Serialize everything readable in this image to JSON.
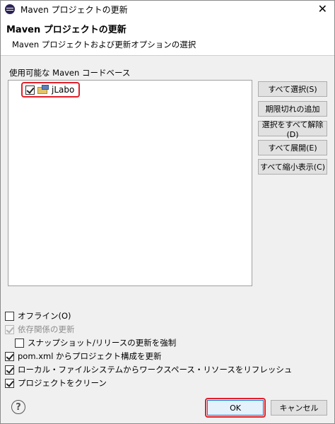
{
  "window": {
    "title": "Maven プロジェクトの更新",
    "close_glyph": "✕"
  },
  "banner": {
    "title": "Maven プロジェクトの更新",
    "description": "Maven プロジェクトおよび更新オプションの選択"
  },
  "codebases": {
    "label": "使用可能な Maven コードベース",
    "items": [
      {
        "label": "jLabo",
        "checked": true
      }
    ]
  },
  "side_buttons": {
    "select_all": "すべて選択(S)",
    "add_out_of_date": "期限切れの追加",
    "deselect_all": "選択をすべて解除(D)",
    "expand_all": "すべて展開(E)",
    "collapse_all": "すべて縮小表示(C)"
  },
  "options": {
    "offline": {
      "label": "オフライン(O)",
      "checked": false
    },
    "update_dependencies": {
      "label": "依存関係の更新",
      "checked": true,
      "disabled": true
    },
    "force_update_snapshots": {
      "label": "スナップショット/リリースの更新を強制",
      "checked": false
    },
    "update_config": {
      "label": "pom.xml からプロジェクト構成を更新",
      "checked": true
    },
    "refresh_local": {
      "label": "ローカル・ファイルシステムからワークスペース・リソースをリフレッシュ",
      "checked": true
    },
    "clean_projects": {
      "label": "プロジェクトをクリーン",
      "checked": true
    }
  },
  "footer": {
    "help_glyph": "?",
    "ok": "OK",
    "cancel": "キャンセル"
  },
  "colors": {
    "highlight": "#e0202a",
    "default_button_border": "#0078d7"
  }
}
